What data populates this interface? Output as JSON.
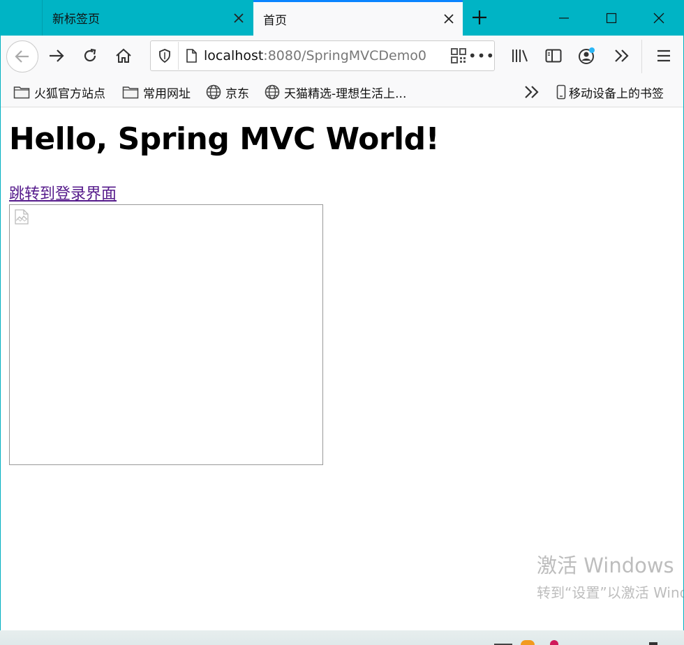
{
  "tabs": [
    {
      "label": "新标签页",
      "active": false
    },
    {
      "label": "首页",
      "active": true
    }
  ],
  "url": {
    "host": "localhost",
    "rest": ":8080/SpringMVCDemo0"
  },
  "bookmarks": {
    "items": [
      {
        "label": "火狐官方站点",
        "icon": "folder-icon"
      },
      {
        "label": "常用网址",
        "icon": "folder-icon"
      },
      {
        "label": "京东",
        "icon": "globe-icon"
      },
      {
        "label": "天猫精选-理想生活上...",
        "icon": "globe-icon"
      }
    ],
    "mobile": "移动设备上的书签"
  },
  "page": {
    "heading": "Hello, Spring MVC World!",
    "link": "跳转到登录界面"
  },
  "watermark": {
    "title": "激活 Windows",
    "subtitle": "转到“设置”以激活 Windows。"
  },
  "colors": {
    "titlebar": "#00b4c5",
    "active_tab_accent": "#0a84ff",
    "visited_link": "#551a8b"
  }
}
